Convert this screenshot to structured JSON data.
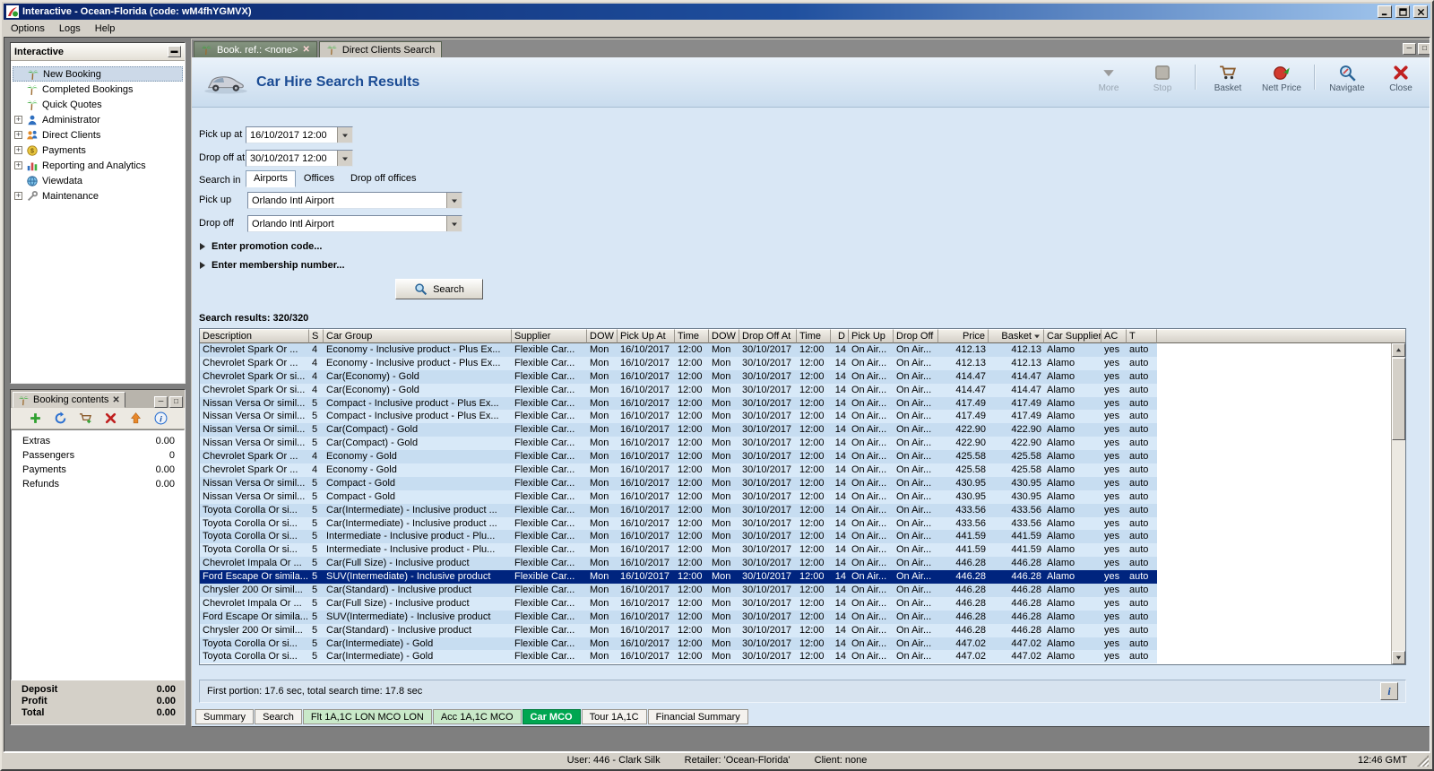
{
  "window": {
    "title": "Interactive - Ocean-Florida (code: wM4fhYGMVX)"
  },
  "menubar": {
    "items": [
      "Options",
      "Logs",
      "Help"
    ]
  },
  "sidebar": {
    "title": "Interactive",
    "items": [
      {
        "label": "New Booking",
        "icon": "palm-tree-icon",
        "expandable": false,
        "selected": true
      },
      {
        "label": "Completed Bookings",
        "icon": "palm-tree-icon",
        "expandable": false
      },
      {
        "label": "Quick Quotes",
        "icon": "palm-tree-icon",
        "expandable": false
      },
      {
        "label": "Administrator",
        "icon": "administrator-icon",
        "expandable": true
      },
      {
        "label": "Direct Clients",
        "icon": "clients-icon",
        "expandable": true
      },
      {
        "label": "Payments",
        "icon": "payments-icon",
        "expandable": true
      },
      {
        "label": "Reporting and Analytics",
        "icon": "reporting-icon",
        "expandable": true
      },
      {
        "label": "Viewdata",
        "icon": "viewdata-icon",
        "expandable": false
      },
      {
        "label": "Maintenance",
        "icon": "maintenance-icon",
        "expandable": true
      }
    ]
  },
  "booking_contents": {
    "title": "Booking contents",
    "toolbar_icons": [
      "add-icon",
      "refresh-icon",
      "basket-add-icon",
      "delete-icon",
      "move-up-icon",
      "info-icon"
    ],
    "rows": [
      {
        "label": "Extras",
        "value": "0.00"
      },
      {
        "label": "Passengers",
        "value": "0"
      },
      {
        "label": "Payments",
        "value": "0.00"
      },
      {
        "label": "Refunds",
        "value": "0.00"
      }
    ],
    "totals": [
      {
        "label": "Deposit",
        "value": "0.00"
      },
      {
        "label": "Profit",
        "value": "0.00"
      },
      {
        "label": "Total",
        "value": "0.00"
      }
    ]
  },
  "doc_tabs": [
    {
      "label": "Book. ref.: <none>",
      "active": true,
      "closable": true
    },
    {
      "label": "Direct Clients Search",
      "active": false,
      "closable": false
    }
  ],
  "header": {
    "title": "Car Hire Search Results",
    "buttons": [
      {
        "label": "More",
        "icon": "more-icon",
        "disabled": true
      },
      {
        "label": "Stop",
        "icon": "stop-icon",
        "disabled": true
      },
      {
        "label": "Basket",
        "icon": "basket-icon",
        "disabled": false
      },
      {
        "label": "Nett Price",
        "icon": "nett-price-icon",
        "disabled": false
      },
      {
        "label": "Navigate",
        "icon": "navigate-icon",
        "disabled": false
      },
      {
        "label": "Close",
        "icon": "close-icon",
        "disabled": false
      }
    ]
  },
  "form": {
    "pickup_at_label": "Pick up at",
    "pickup_at_value": "16/10/2017 12:00",
    "dropoff_at_label": "Drop off at",
    "dropoff_at_value": "30/10/2017 12:00",
    "search_in_label": "Search in",
    "search_in_tabs": [
      "Airports",
      "Offices",
      "Drop off offices"
    ],
    "search_in_active": "Airports",
    "pickup_label": "Pick up",
    "pickup_value": "Orlando Intl Airport",
    "dropoff_label": "Drop off",
    "dropoff_value": "Orlando Intl Airport",
    "promo_label": "Enter promotion code...",
    "membership_label": "Enter membership number...",
    "search_button": "Search"
  },
  "results": {
    "summary": "Search results: 320/320",
    "columns": [
      "Description",
      "S",
      "Car Group",
      "Supplier",
      "DOW",
      "Pick Up At",
      "Time",
      "DOW",
      "Drop Off At",
      "Time",
      "D",
      "Pick Up",
      "Drop Off",
      "Price",
      "Basket",
      "Car Supplier",
      "AC",
      "T"
    ],
    "sort_column": "Basket",
    "common": {
      "supplier": "Flexible Car...",
      "dow1": "Mon",
      "pickup_date": "16/10/2017",
      "time1": "12:00",
      "dow2": "Mon",
      "dropoff_date": "30/10/2017",
      "time2": "12:00",
      "days": "14",
      "pickup_loc": "On Air...",
      "dropoff_loc": "On Air...",
      "car_supplier": "Alamo",
      "ac": "yes",
      "t": "auto"
    },
    "rows": [
      {
        "desc": "Chevrolet Spark Or ...",
        "s": "4",
        "group": "Economy - Inclusive product - Plus Ex...",
        "price": "412.13"
      },
      {
        "desc": "Chevrolet Spark Or ...",
        "s": "4",
        "group": "Economy - Inclusive product - Plus Ex...",
        "price": "412.13"
      },
      {
        "desc": "Chevrolet Spark Or si...",
        "s": "4",
        "group": "Car(Economy) - Gold",
        "price": "414.47"
      },
      {
        "desc": "Chevrolet Spark Or si...",
        "s": "4",
        "group": "Car(Economy) - Gold",
        "price": "414.47"
      },
      {
        "desc": "Nissan Versa Or simil...",
        "s": "5",
        "group": "Compact - Inclusive product - Plus Ex...",
        "price": "417.49"
      },
      {
        "desc": "Nissan Versa Or simil...",
        "s": "5",
        "group": "Compact - Inclusive product - Plus Ex...",
        "price": "417.49"
      },
      {
        "desc": "Nissan Versa Or simil...",
        "s": "5",
        "group": "Car(Compact) - Gold",
        "price": "422.90"
      },
      {
        "desc": "Nissan Versa Or simil...",
        "s": "5",
        "group": "Car(Compact) - Gold",
        "price": "422.90"
      },
      {
        "desc": "Chevrolet Spark Or ...",
        "s": "4",
        "group": "Economy - Gold",
        "price": "425.58"
      },
      {
        "desc": "Chevrolet Spark Or ...",
        "s": "4",
        "group": "Economy - Gold",
        "price": "425.58"
      },
      {
        "desc": "Nissan Versa Or simil...",
        "s": "5",
        "group": "Compact - Gold",
        "price": "430.95"
      },
      {
        "desc": "Nissan Versa Or simil...",
        "s": "5",
        "group": "Compact - Gold",
        "price": "430.95"
      },
      {
        "desc": "Toyota Corolla Or si...",
        "s": "5",
        "group": "Car(Intermediate) - Inclusive product ...",
        "price": "433.56"
      },
      {
        "desc": "Toyota Corolla Or si...",
        "s": "5",
        "group": "Car(Intermediate) - Inclusive product ...",
        "price": "433.56"
      },
      {
        "desc": "Toyota Corolla Or si...",
        "s": "5",
        "group": "Intermediate - Inclusive product - Plu...",
        "price": "441.59"
      },
      {
        "desc": "Toyota Corolla Or si...",
        "s": "5",
        "group": "Intermediate - Inclusive product - Plu...",
        "price": "441.59"
      },
      {
        "desc": "Chevrolet Impala Or ...",
        "s": "5",
        "group": "Car(Full Size) - Inclusive product",
        "price": "446.28"
      },
      {
        "desc": "Ford Escape Or simila...",
        "s": "5",
        "group": "SUV(Intermediate) - Inclusive product",
        "price": "446.28",
        "selected": true
      },
      {
        "desc": "Chrysler 200 Or simil...",
        "s": "5",
        "group": "Car(Standard) - Inclusive product",
        "price": "446.28"
      },
      {
        "desc": "Chevrolet Impala Or ...",
        "s": "5",
        "group": "Car(Full Size) - Inclusive product",
        "price": "446.28"
      },
      {
        "desc": "Ford Escape Or simila...",
        "s": "5",
        "group": "SUV(Intermediate) - Inclusive product",
        "price": "446.28"
      },
      {
        "desc": "Chrysler 200 Or simil...",
        "s": "5",
        "group": "Car(Standard) - Inclusive product",
        "price": "446.28"
      },
      {
        "desc": "Toyota Corolla Or si...",
        "s": "5",
        "group": "Car(Intermediate) - Gold",
        "price": "447.02"
      },
      {
        "desc": "Toyota Corolla Or si...",
        "s": "5",
        "group": "Car(Intermediate) - Gold",
        "price": "447.02"
      }
    ],
    "status": "First portion: 17.6 sec, total search time: 17.8 sec"
  },
  "bottom_tabs": [
    {
      "label": "Summary",
      "variant": "plain"
    },
    {
      "label": "Search",
      "variant": "plain"
    },
    {
      "label": "Flt 1A,1C LON MCO LON",
      "variant": "pale"
    },
    {
      "label": "Acc 1A,1C MCO",
      "variant": "pale"
    },
    {
      "label": "Car MCO",
      "variant": "green"
    },
    {
      "label": "Tour 1A,1C",
      "variant": "plain"
    },
    {
      "label": "Financial Summary",
      "variant": "plain"
    }
  ],
  "statusbar": {
    "user": "User: 446 - Clark Silk",
    "retailer": "Retailer: 'Ocean-Florida'",
    "client": "Client: none",
    "time": "12:46 GMT"
  },
  "colors": {
    "selected_row": "#00247e",
    "active_tab_green": "#00a651",
    "title_blue": "#1b4c94"
  }
}
